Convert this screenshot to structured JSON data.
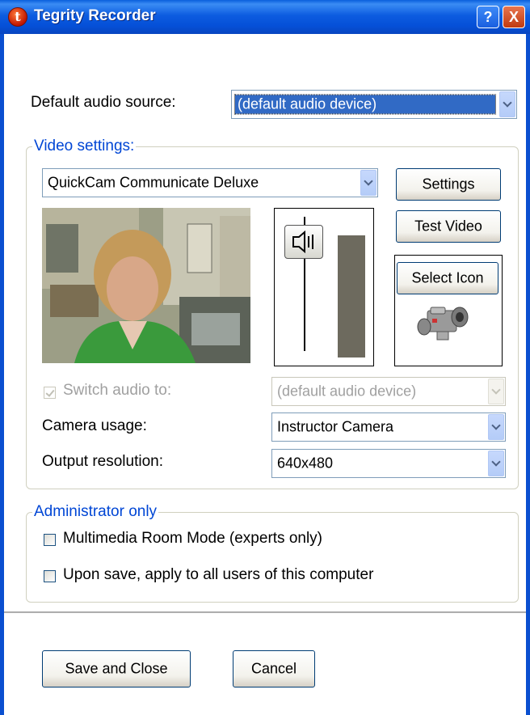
{
  "window": {
    "title": "Tegrity Recorder",
    "app_icon_letter": "t",
    "help_symbol": "?",
    "close_symbol": "X"
  },
  "audio": {
    "label": "Default audio source:",
    "selected": "(default audio device)"
  },
  "video_settings": {
    "legend": "Video settings:",
    "camera_selected": "QuickCam Communicate Deluxe",
    "settings_button": "Settings",
    "test_video_button": "Test Video",
    "select_icon_button": "Select Icon",
    "switch_audio_label": "Switch audio to:",
    "switch_audio_checked": true,
    "switch_audio_value": "(default audio device)",
    "camera_usage_label": "Camera usage:",
    "camera_usage_value": "Instructor Camera",
    "output_resolution_label": "Output resolution:",
    "output_resolution_value": "640x480",
    "volume_level": 0.88
  },
  "admin": {
    "legend": "Administrator only",
    "multimedia_room_label": "Multimedia Room Mode (experts only)",
    "multimedia_room_checked": false,
    "apply_all_label": "Upon save, apply to all users of this computer",
    "apply_all_checked": false
  },
  "footer": {
    "save_close": "Save and Close",
    "cancel": "Cancel"
  },
  "colors": {
    "titlebar": "#0550d8",
    "legend_text": "#0046d5",
    "selection": "#316ac5"
  }
}
